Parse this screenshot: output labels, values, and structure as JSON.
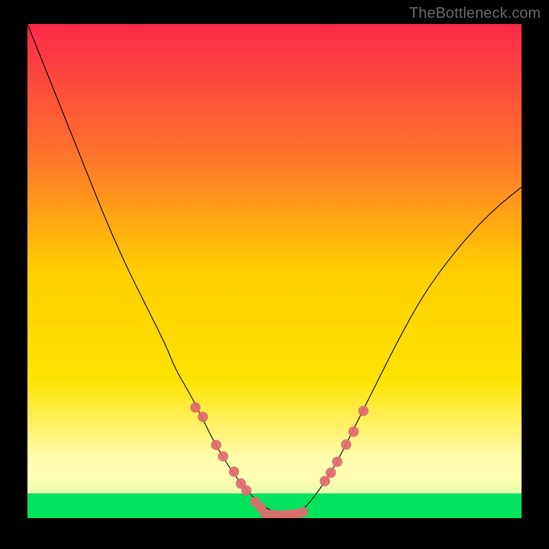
{
  "watermark": "TheBottleneck.com",
  "chart_data": {
    "type": "line",
    "title": "",
    "xlabel": "",
    "ylabel": "",
    "xlim": [
      0,
      100
    ],
    "ylim": [
      0,
      100
    ],
    "background_gradient": {
      "top": "#fb2a49",
      "mid": "#ffe300",
      "bottom": "#00e35d"
    },
    "green_band": {
      "y0": 0,
      "y1": 5
    },
    "pale_band": {
      "y0": 5,
      "y1": 13
    },
    "series": [
      {
        "name": "curve",
        "type": "line",
        "color": "#000000",
        "x": [
          0,
          4,
          8,
          12,
          16,
          20,
          24,
          28,
          30,
          33,
          36,
          38,
          41,
          44,
          47,
          50,
          53,
          55,
          57,
          60,
          63,
          66,
          70,
          75,
          80,
          85,
          90,
          95,
          100
        ],
        "y": [
          100,
          90,
          80,
          70,
          60,
          51,
          43,
          35,
          30,
          25,
          19,
          15,
          10,
          6,
          3,
          1,
          0.5,
          1,
          3,
          7,
          12,
          18,
          26,
          36,
          45,
          52,
          58,
          63,
          67
        ]
      },
      {
        "name": "markers-left",
        "type": "scatter",
        "color": "#e06a6f",
        "x": [
          34,
          35.5,
          38.2,
          39.6,
          41.8,
          43.2,
          44.3,
          46.1,
          47.3
        ],
        "y": [
          22.4,
          20.5,
          14.8,
          12.5,
          9.4,
          7,
          5.6,
          3.3,
          2.1
        ]
      },
      {
        "name": "markers-bottom",
        "type": "scatter",
        "color": "#e06a6f",
        "x": [
          48.2,
          49.5,
          50.6,
          52.1,
          53.3,
          54.6,
          55.8
        ],
        "y": [
          0.9,
          0.7,
          0.6,
          0.6,
          0.7,
          0.9,
          1.2
        ]
      },
      {
        "name": "markers-right",
        "type": "scatter",
        "color": "#e06a6f",
        "x": [
          60.2,
          61.4,
          62.7,
          64.5,
          66,
          68
        ],
        "y": [
          7.5,
          9.2,
          11.4,
          14.9,
          17.5,
          21.7
        ]
      }
    ]
  }
}
